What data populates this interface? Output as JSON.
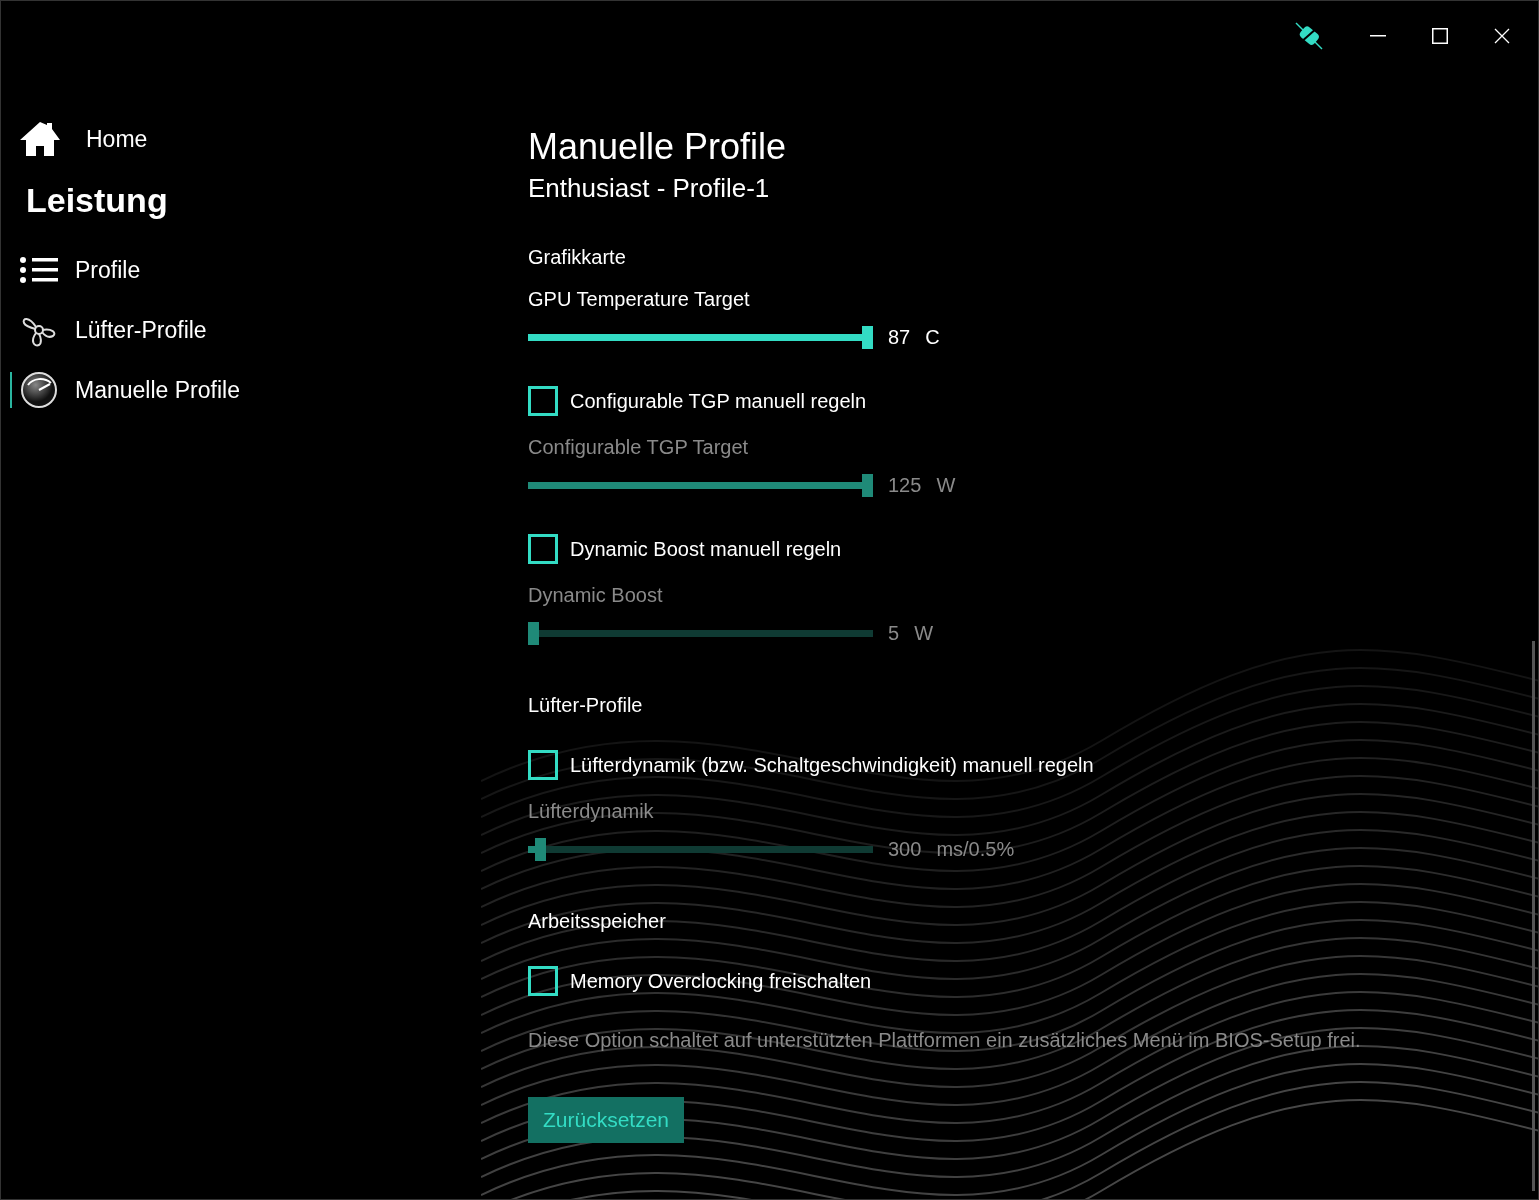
{
  "sidebar": {
    "home": {
      "label": "Home"
    },
    "heading": "Leistung",
    "items": [
      {
        "label": "Profile",
        "selected": false
      },
      {
        "label": "Lüfter-Profile",
        "selected": false
      },
      {
        "label": "Manuelle Profile",
        "selected": true
      }
    ]
  },
  "page": {
    "title": "Manuelle Profile",
    "subtitle": "Enthusiast - Profile-1"
  },
  "sections": [
    {
      "heading": "Grafikkarte",
      "items": [
        {
          "kind": "slider",
          "label": "GPU Temperature Target",
          "value": "87",
          "unit": "C",
          "level": 1,
          "disabled": false
        },
        {
          "kind": "checkbox",
          "label": "Configurable TGP manuell regeln",
          "checked": false
        },
        {
          "kind": "slider",
          "label": "Configurable TGP Target",
          "value": "125",
          "unit": "W",
          "level": 1,
          "disabled": true
        },
        {
          "kind": "checkbox",
          "label": "Dynamic Boost manuell regeln",
          "checked": false
        },
        {
          "kind": "slider",
          "label": "Dynamic Boost",
          "value": "5",
          "unit": "W",
          "level": 0,
          "disabled": true
        }
      ]
    },
    {
      "heading": "Lüfter-Profile",
      "items": [
        {
          "kind": "checkbox",
          "label": "Lüfterdynamik (bzw. Schaltgeschwindigkeit) manuell regeln",
          "checked": false
        },
        {
          "kind": "slider",
          "label": "Lüfterdynamik",
          "value": "300",
          "unit": "ms/0.5%",
          "level": 0.02,
          "disabled": true
        }
      ]
    },
    {
      "heading": "Arbeitsspeicher",
      "items": [
        {
          "kind": "checkbox",
          "label": "Memory Overclocking freischalten",
          "checked": false
        },
        {
          "kind": "note",
          "label": "Diese Option schaltet auf unterstützten Plattformen ein zusätzliches Menü im BIOS-Setup frei."
        }
      ]
    }
  ],
  "reset_button": "Zurücksetzen"
}
